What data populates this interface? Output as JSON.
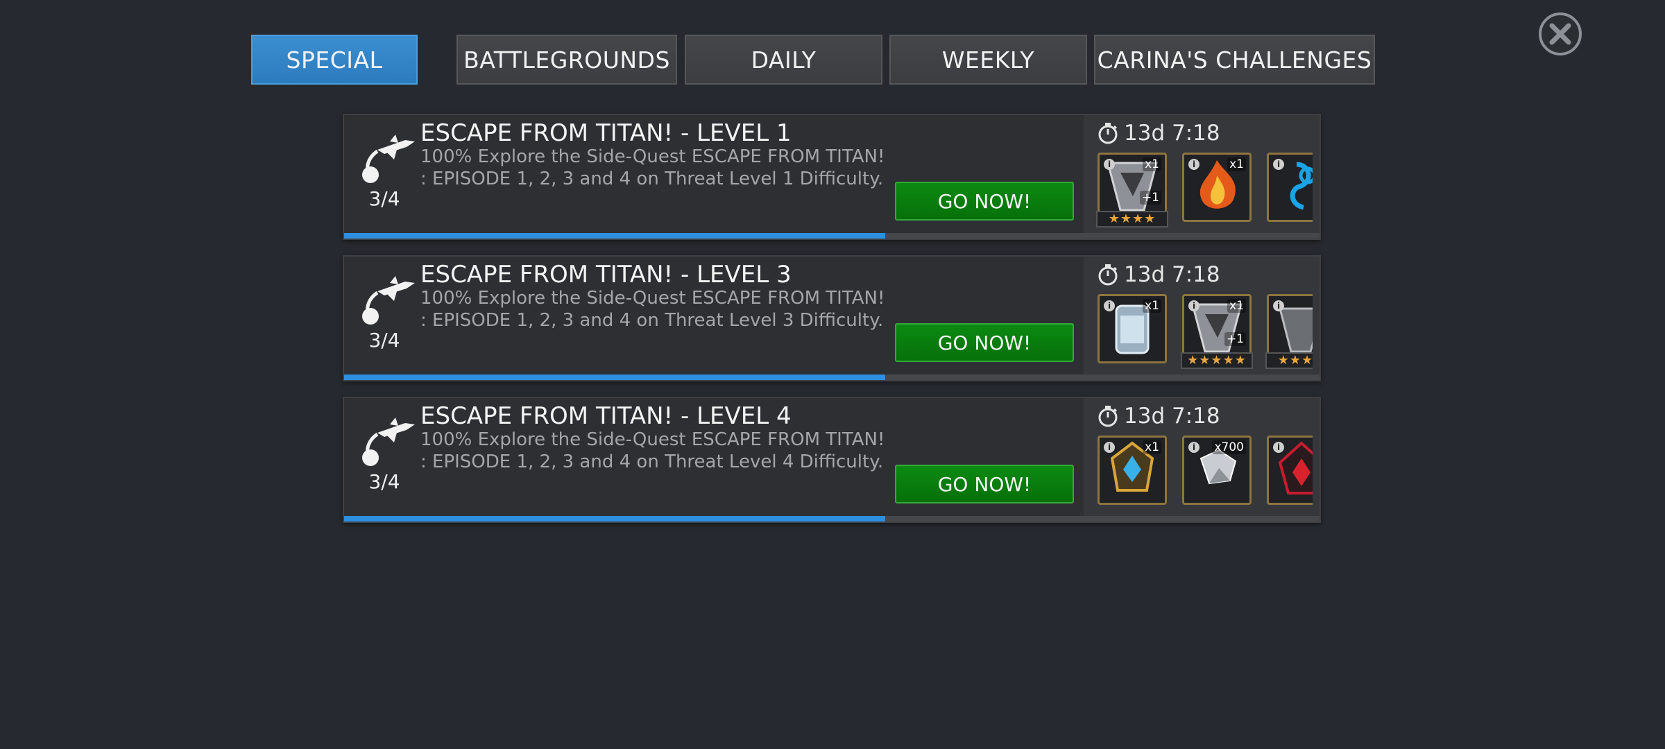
{
  "tabs": [
    {
      "label": "SPECIAL",
      "active": true
    },
    {
      "label": "BATTLEGROUNDS",
      "active": false
    },
    {
      "label": "DAILY",
      "active": false
    },
    {
      "label": "WEEKLY",
      "active": false
    },
    {
      "label": "CARINA'S CHALLENGES",
      "active": false
    }
  ],
  "close_icon": "close-icon",
  "quests": [
    {
      "title": "ESCAPE FROM TITAN! - LEVEL 1",
      "desc_line1": "100% Explore the Side-Quest ESCAPE FROM TITAN!",
      "desc_line2": ": EPISODE 1, 2, 3 and 4 on Threat Level 1 Difficulty.",
      "progress_text": "3/4",
      "progress_fraction": 0.75,
      "button_label": "GO NOW!",
      "timer": "13d 7:18",
      "rewards": [
        {
          "icon": "silver-crystal-icon",
          "qty": "x1",
          "badge": "+1",
          "stars": "★★★★"
        },
        {
          "icon": "fire-crystal-icon",
          "qty": "x1"
        },
        {
          "icon": "blue-catalyst-icon"
        }
      ]
    },
    {
      "title": "ESCAPE FROM TITAN! - LEVEL 3",
      "desc_line1": "100% Explore the Side-Quest ESCAPE FROM TITAN!",
      "desc_line2": ": EPISODE 1, 2, 3 and 4 on Threat Level 3 Difficulty.",
      "progress_text": "3/4",
      "progress_fraction": 0.75,
      "button_label": "GO NOW!",
      "timer": "13d 7:18",
      "rewards": [
        {
          "icon": "canister-icon",
          "qty": "x1"
        },
        {
          "icon": "silver-crystal-icon",
          "qty": "x1",
          "badge": "+1",
          "stars": "★★★★★"
        },
        {
          "icon": "gray-crystal-icon",
          "stars": "★★★★"
        }
      ]
    },
    {
      "title": "ESCAPE FROM TITAN! - LEVEL 4",
      "desc_line1": "100% Explore the Side-Quest ESCAPE FROM TITAN!",
      "desc_line2": ": EPISODE 1, 2, 3 and 4 on Threat Level 4 Difficulty.",
      "progress_text": "3/4",
      "progress_fraction": 0.75,
      "button_label": "GO NOW!",
      "timer": "13d 7:18",
      "rewards": [
        {
          "icon": "gold-crystal-icon",
          "qty": "x1"
        },
        {
          "icon": "iso-shards-icon",
          "qty": "x700"
        },
        {
          "icon": "red-crystal-icon"
        }
      ]
    }
  ],
  "colors": {
    "accent": "#2d7bbf",
    "go": "#067009",
    "progress": "#2e8fe0",
    "star": "#e8a53b"
  }
}
